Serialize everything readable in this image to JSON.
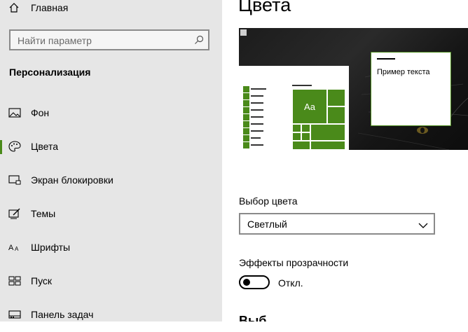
{
  "sidebar": {
    "home_label": "Главная",
    "search_placeholder": "Найти параметр",
    "section_title": "Персонализация",
    "items": [
      {
        "label": "Фон",
        "icon": "image-icon"
      },
      {
        "label": "Цвета",
        "icon": "palette-icon",
        "active": true
      },
      {
        "label": "Экран блокировки",
        "icon": "lock-screen-icon"
      },
      {
        "label": "Темы",
        "icon": "themes-icon"
      },
      {
        "label": "Шрифты",
        "icon": "fonts-icon"
      },
      {
        "label": "Пуск",
        "icon": "start-icon"
      },
      {
        "label": "Панель задач",
        "icon": "taskbar-icon"
      }
    ]
  },
  "main": {
    "title": "Цвета",
    "preview": {
      "sample_text": "Пример текста",
      "tile_text": "Aa"
    },
    "color_choice": {
      "label": "Выбор цвета",
      "value": "Светлый"
    },
    "transparency": {
      "label": "Эффекты прозрачности",
      "state": "Откл."
    },
    "next_section_partial": "Выб"
  },
  "colors": {
    "accent": "#4a8a1a",
    "sidebar_bg": "#e6e6e6"
  }
}
